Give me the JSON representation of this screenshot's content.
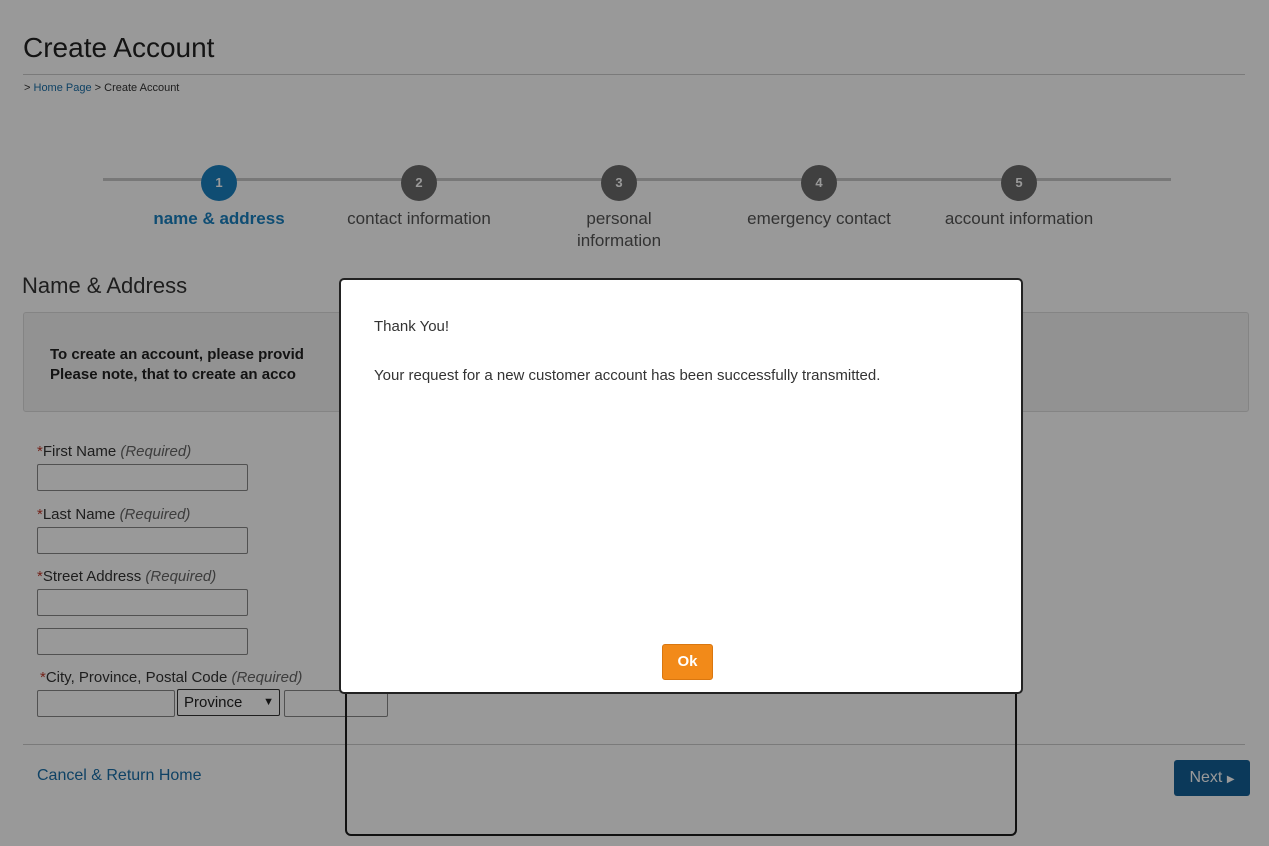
{
  "page": {
    "title": "Create Account",
    "breadcrumb": {
      "prefix": ">",
      "home": "Home Page",
      "separator": ">",
      "current": "Create Account"
    }
  },
  "steps": [
    {
      "number": "1",
      "label": "name & address",
      "active": true
    },
    {
      "number": "2",
      "label": "contact information",
      "active": false
    },
    {
      "number": "3",
      "label": "personal information",
      "active": false
    },
    {
      "number": "4",
      "label": "emergency contact",
      "active": false
    },
    {
      "number": "5",
      "label": "account information",
      "active": false
    }
  ],
  "section": {
    "title": "Name & Address",
    "notice_line1": "To create an account, please provid",
    "notice_line2": "Please note, that to create an acco"
  },
  "fields": {
    "first_name": {
      "label": "First Name",
      "required_note": "(Required)",
      "value": ""
    },
    "last_name": {
      "label": "Last Name",
      "required_note": "(Required)",
      "value": ""
    },
    "street": {
      "label": "Street Address",
      "required_note": "(Required)",
      "value": "",
      "value2": ""
    },
    "city": {
      "label": "City, Province, Postal Code",
      "required_note": "(Required)",
      "value": "",
      "postal": ""
    },
    "province_selected": "Province"
  },
  "footer": {
    "cancel_label": "Cancel & Return Home",
    "next_label": "Next"
  },
  "modal": {
    "title": "Thank You!",
    "message": "Your request for a new customer account has been successfully transmitted.",
    "ok_label": "Ok"
  },
  "colors": {
    "accent": "#1a80c0",
    "next_button": "#135f96",
    "ok_button": "#f28a19",
    "required": "#c0392b"
  }
}
